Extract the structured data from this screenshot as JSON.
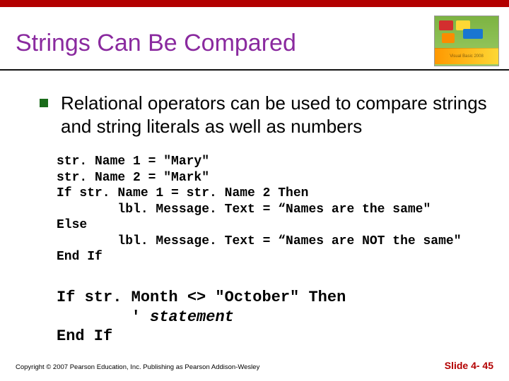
{
  "title": "Strings Can Be Compared",
  "bullet": "Relational operators can be used to compare strings and string literals as well as numbers",
  "code1_lines": [
    "str. Name 1 = \"Mary\"",
    "str. Name 2 = \"Mark\"",
    "If str. Name 1 = str. Name 2 Then",
    "        lbl. Message. Text = “Names are the same\"",
    "Else",
    "        lbl. Message. Text = “Names are NOT the same\"",
    "End If"
  ],
  "code2_line1": "If str. Month <> \"October\" Then",
  "code2_line2_prefix": "        ' ",
  "code2_line2_italic": "statement",
  "code2_line3": "End If",
  "footer_left": "Copyright © 2007 Pearson Education, Inc. Publishing as Pearson Addison-Wesley",
  "footer_right": "Slide 4- 45",
  "book_label": "Visual Basic 2008"
}
